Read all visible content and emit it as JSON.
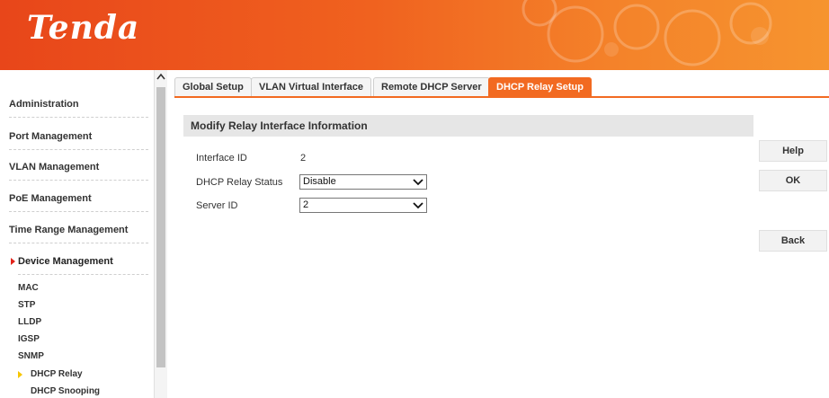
{
  "header": {
    "logo": "Tenda"
  },
  "sidebar": {
    "items": [
      {
        "label": "Administration"
      },
      {
        "label": "Port Management"
      },
      {
        "label": "VLAN Management"
      },
      {
        "label": "PoE Management"
      },
      {
        "label": "Time Range Management"
      },
      {
        "label": "Device Management"
      }
    ],
    "sub_items": [
      {
        "label": "MAC"
      },
      {
        "label": "STP"
      },
      {
        "label": "LLDP"
      },
      {
        "label": "IGSP"
      },
      {
        "label": "SNMP"
      },
      {
        "label": "DHCP Relay"
      },
      {
        "label": "DHCP Snooping"
      }
    ],
    "scroll_up_glyph": "^"
  },
  "tabs": [
    {
      "label": "Global Setup"
    },
    {
      "label": "VLAN Virtual Interface"
    },
    {
      "label": "Remote DHCP Server"
    },
    {
      "label": "DHCP Relay Setup"
    }
  ],
  "panel": {
    "title": "Modify Relay Interface Information",
    "interface_id_label": "Interface ID",
    "interface_id_value": "2",
    "relay_status_label": "DHCP Relay Status",
    "relay_status_value": "Disable",
    "server_id_label": "Server ID",
    "server_id_value": "2"
  },
  "buttons": {
    "help": "Help",
    "ok": "OK",
    "back": "Back"
  },
  "colors": {
    "accent": "#f26a21",
    "header_start": "#e8461a",
    "header_end": "#f6942f",
    "active_marker": "#e2231a",
    "sub_marker": "#f7c600"
  },
  "icons": {
    "select_chevron": "chevron-down-icon",
    "scroll_up": "chevron-up-icon",
    "device_mgmt_marker": "triangle-right-icon",
    "dhcp_relay_marker": "triangle-right-icon"
  }
}
